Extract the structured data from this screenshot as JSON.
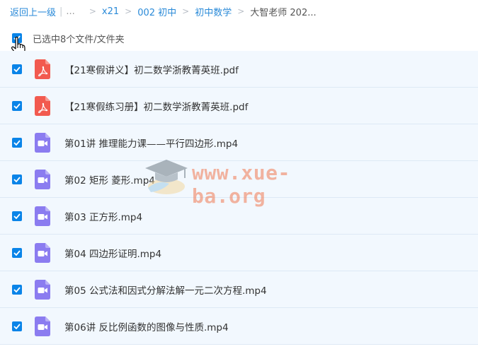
{
  "breadcrumb": {
    "back_label": "返回上一级",
    "separator": "|",
    "ellipsis": "...",
    "items": [
      "x21",
      "002 初中",
      "初中数学"
    ],
    "current": "大智老师 202..."
  },
  "selection": {
    "checked": true,
    "text": "已选中8个文件/文件夹"
  },
  "files": [
    {
      "name": "【21寒假讲义】初二数学浙教菁英班.pdf",
      "type": "pdf",
      "checked": true
    },
    {
      "name": "【21寒假练习册】初二数学浙教菁英班.pdf",
      "type": "pdf",
      "checked": true
    },
    {
      "name": "第01讲 推理能力课——平行四边形.mp4",
      "type": "video",
      "checked": true
    },
    {
      "name": "第02 矩形 菱形.mp4",
      "type": "video",
      "checked": true
    },
    {
      "name": "第03 正方形.mp4",
      "type": "video",
      "checked": true
    },
    {
      "name": "第04 四边形证明.mp4",
      "type": "video",
      "checked": true
    },
    {
      "name": "第05 公式法和因式分解法解一元二次方程.mp4",
      "type": "video",
      "checked": true
    },
    {
      "name": "第06讲 反比例函数的图像与性质.mp4",
      "type": "video",
      "checked": true
    }
  ],
  "watermark": {
    "text": "www.xue-ba.org"
  },
  "colors": {
    "accent": "#0a84e8",
    "link": "#2a8ad8",
    "pdf_icon": "#f25a4f",
    "video_icon": "#8b7cf0",
    "row_bg": "#f2f8fe"
  }
}
